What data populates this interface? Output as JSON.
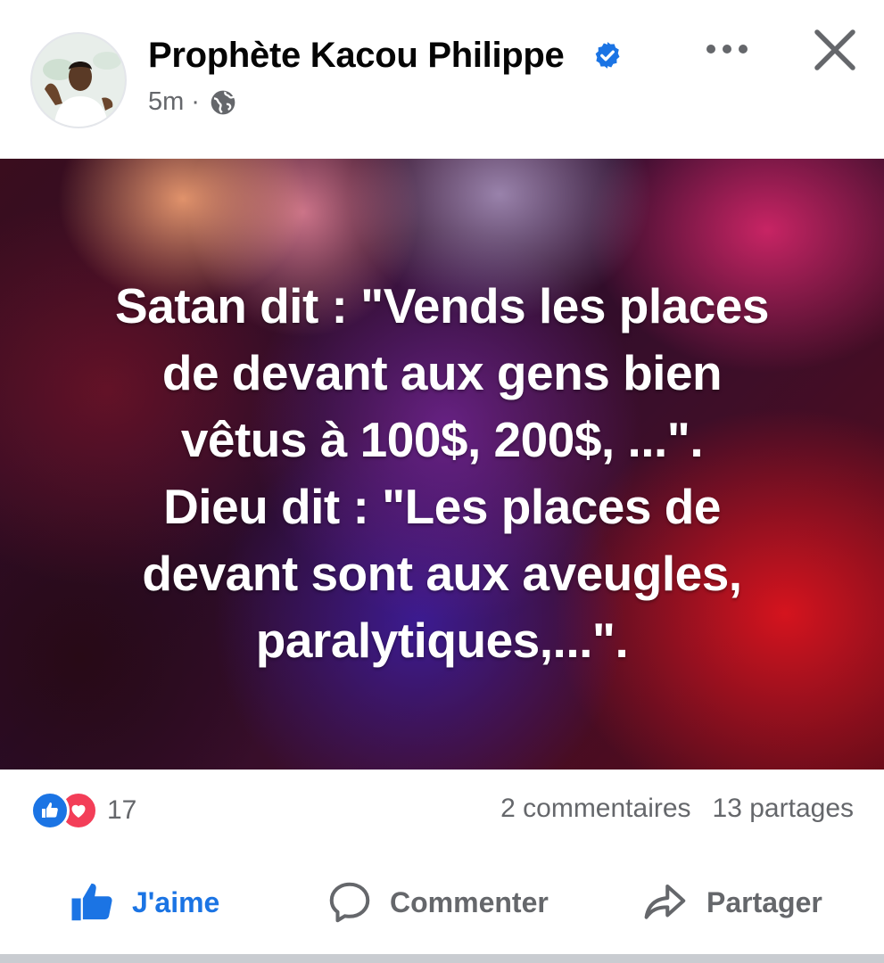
{
  "post": {
    "author": "Prophète Kacou Philippe",
    "verified_icon": "verified-badge-icon",
    "time": "5m",
    "separator": "·",
    "audience_icon": "globe-icon",
    "more_icon": "more-options-icon",
    "close_icon": "close-icon"
  },
  "media": {
    "lines": [
      "Satan dit : \"Vends les places",
      "de devant aux gens bien",
      "vêtus à 100$, 200$, ...\".",
      "Dieu dit : \"Les places de",
      "devant sont aux aveugles,",
      "paralytiques,...\"."
    ]
  },
  "stats": {
    "reaction_icons": [
      "like-reaction-icon",
      "love-reaction-icon"
    ],
    "reaction_count": "17",
    "comments": "2 commentaires",
    "shares": "13 partages"
  },
  "actions": {
    "like_label": "J'aime",
    "comment_label": "Commenter",
    "share_label": "Partager"
  },
  "colors": {
    "accent": "#1b74e4",
    "love": "#f33e58",
    "secondary_text": "#65676b"
  }
}
